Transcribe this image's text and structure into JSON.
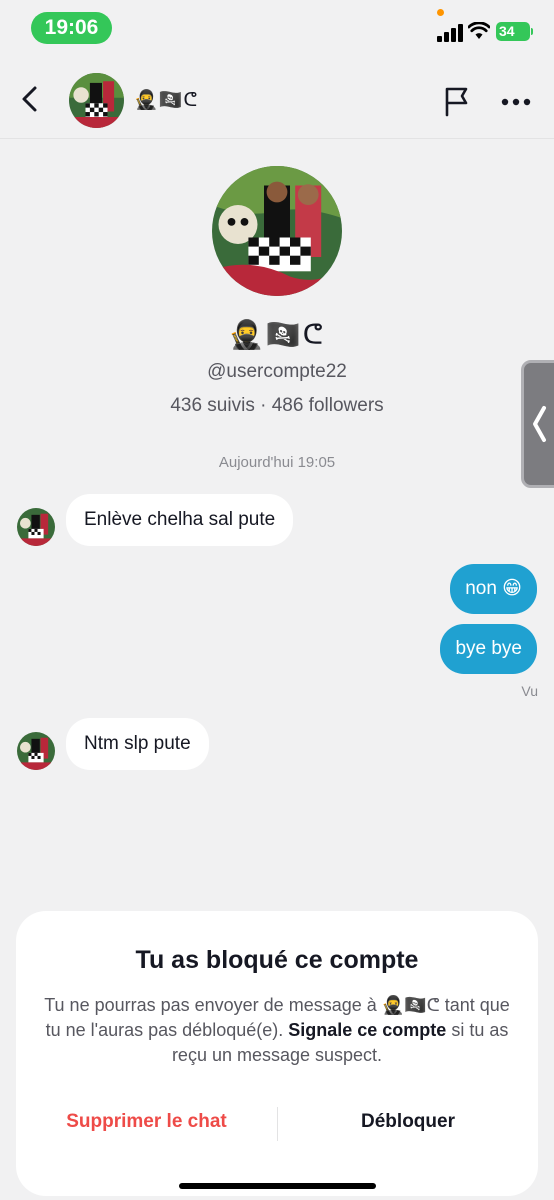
{
  "status_bar": {
    "time": "19:06",
    "battery": "34"
  },
  "header": {
    "contact_name": "🥷🏴‍☠️ᕦ",
    "icons": [
      "back-arrow-icon",
      "flag-icon",
      "more-icon"
    ]
  },
  "profile": {
    "name": "🥷🏴‍☠️ᕦ",
    "handle": "@usercompte22",
    "stats": "436 suivis · 486 followers"
  },
  "chat": {
    "date": "Aujourd'hui 19:05",
    "messages": [
      {
        "from": "them",
        "text": "Enlève chelha sal pute"
      },
      {
        "from": "me",
        "text": "non 😁"
      },
      {
        "from": "me",
        "text": "bye bye"
      },
      {
        "from": "them",
        "text": "Ntm slp pute"
      }
    ],
    "read_status": "Vu"
  },
  "blocked_sheet": {
    "title": "Tu as bloqué ce compte",
    "body_prefix": "Tu ne pourras pas envoyer de message à 🥷🏴‍☠️ᕦ tant que tu ne l'auras pas débloqué(e). ",
    "body_link": "Signale ce compte",
    "body_suffix": " si tu as reçu un message suspect.",
    "delete_label": "Supprimer le chat",
    "unblock_label": "Débloquer"
  },
  "colors": {
    "outgoing_bubble": "#20a1d1",
    "delete_action": "#ee4b48",
    "status_green": "#34c759"
  }
}
